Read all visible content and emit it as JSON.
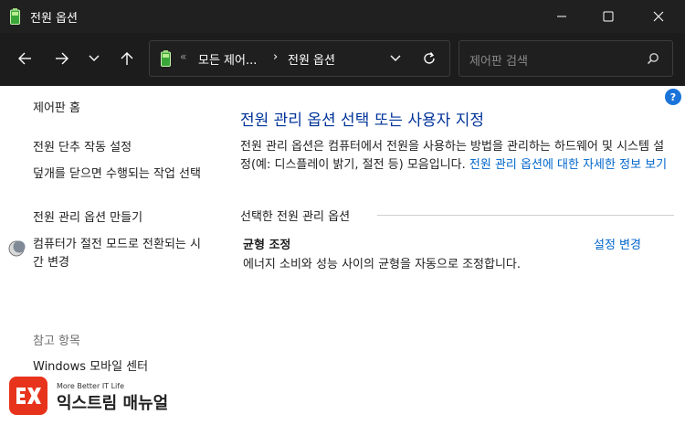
{
  "window": {
    "title": "전원 옵션",
    "controls": [
      "minimize-icon",
      "maximize-icon",
      "close-icon"
    ]
  },
  "nav": {
    "buttons": [
      "back-arrow-icon",
      "forward-arrow-icon",
      "recent-dropdown-icon",
      "up-arrow-icon"
    ],
    "address": {
      "overflow": "«",
      "crumb1": "모든 제어...",
      "separator": "›",
      "crumb2": "전원 옵션"
    },
    "search_placeholder": "제어판 검색"
  },
  "sidebar": {
    "home": "제어판 홈",
    "links": [
      "전원 단추 작동 설정",
      "덮개를 닫으면 수행되는 작업 선택",
      "전원 관리 옵션 만들기",
      "컴퓨터가 절전 모드로 전환되는 시간 변경"
    ],
    "see_also_heading": "참고 항목",
    "see_also": [
      "Windows 모바일 센터"
    ]
  },
  "main": {
    "title": "전원 관리 옵션 선택 또는 사용자 지정",
    "description": "전원 관리 옵션은 컴퓨터에서 전원을 사용하는 방법을 관리하는 하드웨어 및 시스템 설정(예: 디스플레이 밝기, 절전 등) 모음입니다.",
    "description_link": "전원 관리 옵션에 대한 자세한 정보 보기",
    "section_label": "선택한 전원 관리 옵션",
    "plan": {
      "name": "균형 조정",
      "description": "에너지 소비와 성능 사이의 균형을 자동으로 조정합니다.",
      "change_link": "설정 변경"
    },
    "help": "?"
  },
  "watermark": {
    "tagline": "More Better IT Life",
    "name": "익스트림 매뉴얼"
  },
  "colors": {
    "titlebar": "#202020",
    "navbar": "#1c1c1c",
    "title_blue": "#003399",
    "link_blue": "#0066cc",
    "brand_red": "#e8331c"
  }
}
